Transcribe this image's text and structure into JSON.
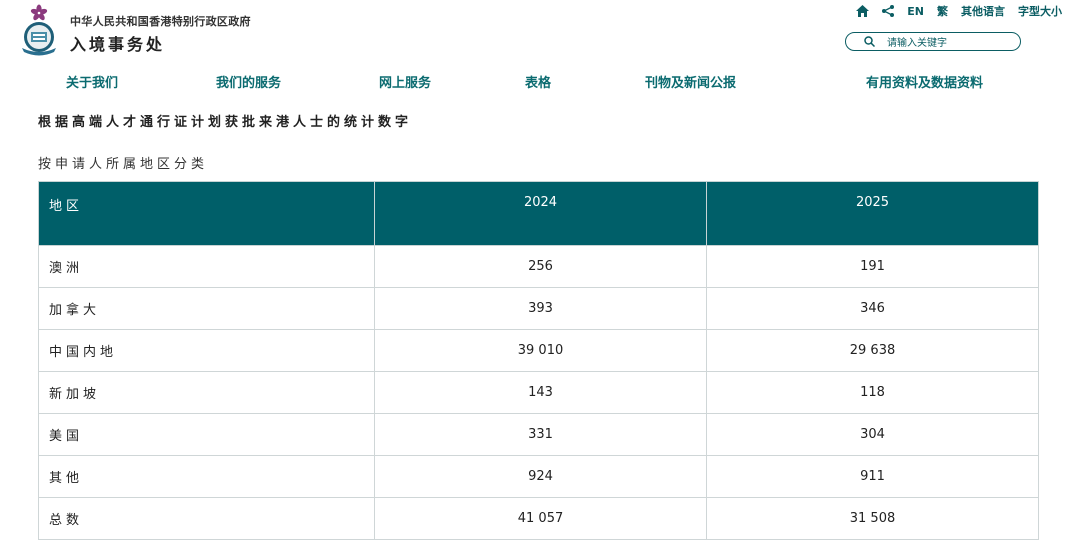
{
  "header": {
    "government_name": "中华人民共和国香港特别行政区政府",
    "department_name": "入境事务处",
    "utility": {
      "home_icon": "home-icon",
      "share_icon": "share-icon",
      "english": "EN",
      "traditional": "繁",
      "other_languages": "其他语言",
      "font_size": "字型大小"
    },
    "search": {
      "placeholder": "请输入关键字",
      "icon": "search-icon"
    }
  },
  "nav": [
    "关于我们",
    "我们的服务",
    "网上服务",
    "表格",
    "刊物及新闻公报",
    "有用资料及数据资料"
  ],
  "page": {
    "title": "根据高端人才通行证计划获批来港人士的统计数字",
    "subtitle": "按申请人所属地区分类"
  },
  "table": {
    "headers": [
      "地区",
      "2024",
      "2025"
    ],
    "rows": [
      [
        "澳洲",
        "256",
        "191"
      ],
      [
        "加拿大",
        "393",
        "346"
      ],
      [
        "中国内地",
        "39 010",
        "29 638"
      ],
      [
        "新加坡",
        "143",
        "118"
      ],
      [
        "美国",
        "331",
        "304"
      ],
      [
        "其他",
        "924",
        "911"
      ],
      [
        "总数",
        "41 057",
        "31 508"
      ]
    ]
  },
  "colors": {
    "header_teal": "#005f69",
    "link_teal": "#0b6b70",
    "logo_purple": "#8b3a7e"
  }
}
